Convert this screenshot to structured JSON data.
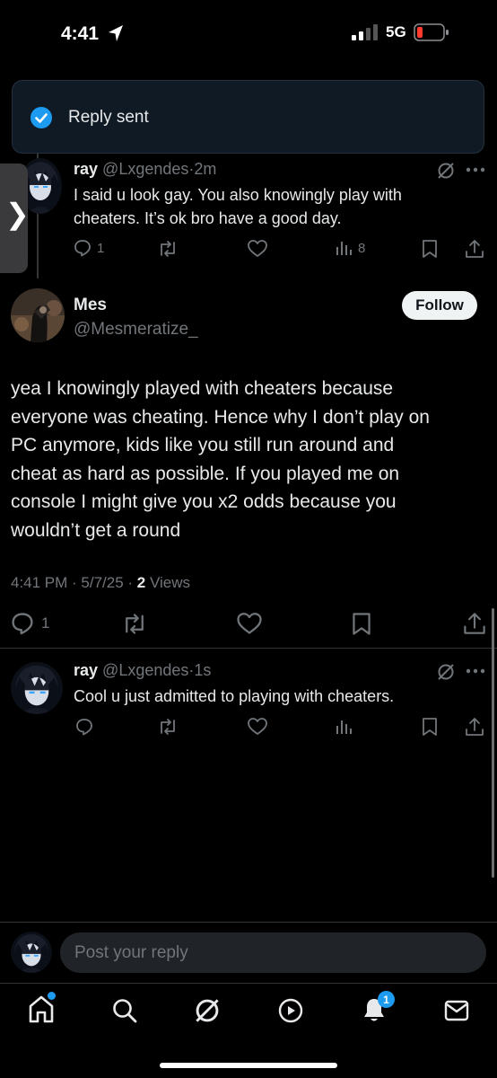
{
  "status_bar": {
    "time": "4:41",
    "network": "5G"
  },
  "toast": {
    "text": "Reply sent"
  },
  "side_tab": {
    "glyph": "❯"
  },
  "reply1": {
    "name": "ray",
    "handle": "@Lxgendes",
    "sep": "·",
    "time": "2m",
    "text_line1": "I said u look gay. You also knowingly play with",
    "text_line2": "cheaters. It’s ok bro have a good day.",
    "reply_count": "1",
    "view_count": "8"
  },
  "main_tweet": {
    "name": "Mes",
    "handle": "@Mesmeratize_",
    "follow_label": "Follow",
    "lines": [
      "yea I knowingly played with cheaters because",
      "everyone was cheating. Hence why I don’t play on",
      "PC anymore, kids like you still run around and",
      "cheat as hard as possible. If you played me on",
      "console I might give you x2 odds because you",
      "wouldn’t get a round"
    ],
    "meta_time": "4:41 PM · 5/7/25 · ",
    "meta_views_count": "2",
    "meta_views_label": " Views",
    "reply_count": "1"
  },
  "reply2": {
    "name": "ray",
    "handle": "@Lxgendes",
    "sep": "·",
    "time": "1s",
    "text": "Cool u just admitted to playing with cheaters."
  },
  "composer": {
    "placeholder": "Post your reply"
  },
  "bottom_nav": {
    "notifications_badge": "1"
  },
  "colors": {
    "accent": "#1d9bf0",
    "background": "#000000",
    "muted": "#71767b",
    "battery_low": "#ff3b30"
  },
  "icons": [
    "location-arrow-icon",
    "signal-bars-icon",
    "battery-icon",
    "check-circle-icon",
    "grok-icon",
    "more-icon",
    "reply-icon",
    "repost-icon",
    "like-icon",
    "views-icon",
    "bookmark-icon",
    "share-icon",
    "home-icon",
    "search-icon",
    "video-icon",
    "bell-icon",
    "mail-icon"
  ]
}
